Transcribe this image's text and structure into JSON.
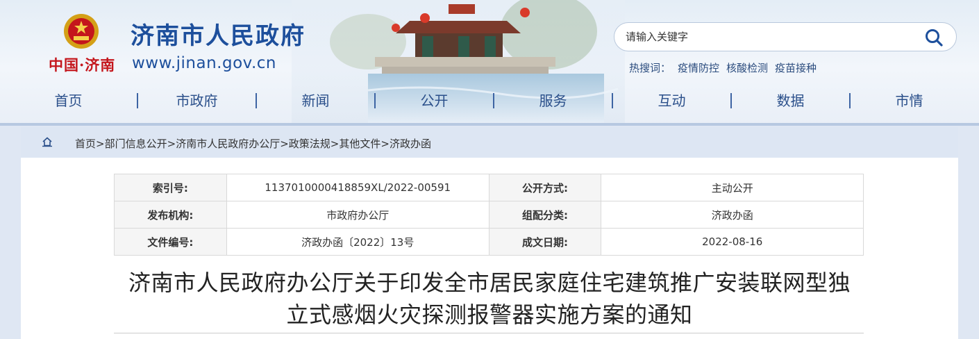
{
  "header": {
    "site_title": "济南市人民政府",
    "site_url": "www.jinan.gov.cn",
    "brand_sub": "中国·济南",
    "search": {
      "placeholder": "请输入关键字"
    },
    "hot_search": {
      "label": "热搜词：",
      "items": [
        "疫情防控",
        "核酸检测",
        "疫苗接种"
      ]
    },
    "icons": [
      "national-emblem-icon",
      "search-icon",
      "home-icon"
    ]
  },
  "nav": {
    "items": [
      "首页",
      "市政府",
      "新闻",
      "公开",
      "服务",
      "互动",
      "数据",
      "市情"
    ]
  },
  "breadcrumb": {
    "items": [
      "首页",
      "部门信息公开",
      "济南市人民政府办公厅",
      "政策法规",
      "其他文件",
      "济政办函"
    ],
    "separator": ">"
  },
  "meta_table": {
    "rows": [
      {
        "k1": "索引号:",
        "v1": "1137010000418859XL/2022-00591",
        "k2": "公开方式:",
        "v2": "主动公开"
      },
      {
        "k1": "发布机构:",
        "v1": "市政府办公厅",
        "k2": "组配分类:",
        "v2": "济政办函"
      },
      {
        "k1": "文件编号:",
        "v1": "济政办函〔2022〕13号",
        "k2": "成文日期:",
        "v2": "2022-08-16"
      }
    ]
  },
  "document": {
    "title_line1": "济南市人民政府办公厅关于印发全市居民家庭住宅建筑推广安装联网型独",
    "title_line2": "立式感烟火灾探测报警器实施方案的通知"
  },
  "colors": {
    "brand_blue": "#1d4f9c",
    "brand_red": "#c4161c",
    "nav_text": "#2a4f8a",
    "page_bg": "#dfe7f3"
  }
}
